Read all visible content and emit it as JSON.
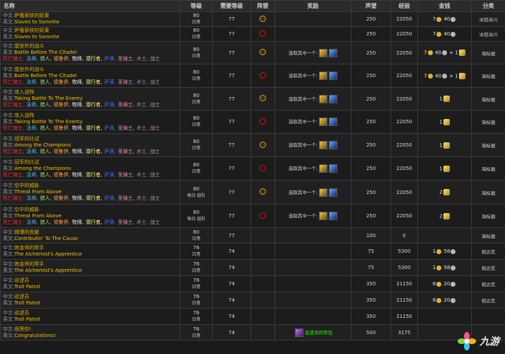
{
  "headers": {
    "name": "名称",
    "level": "等级",
    "req_level": "需要等级",
    "faction": "阵营",
    "reward": "奖励",
    "reputation": "声望",
    "exp": "经验",
    "money": "金钱",
    "category": "分类"
  },
  "prefix_cn": "中文:",
  "prefix_en": "英文:",
  "classes": [
    {
      "label": "死亡骑士,",
      "cls": "c-dk"
    },
    {
      "label": "法师,",
      "cls": "c-mage"
    },
    {
      "label": "猎人,",
      "cls": "c-hunter"
    },
    {
      "label": "德鲁伊,",
      "cls": "c-druid"
    },
    {
      "label": "牧师,",
      "cls": "c-priest"
    },
    {
      "label": "潜行者,",
      "cls": "c-rogue"
    },
    {
      "label": "萨满,",
      "cls": "c-shaman"
    },
    {
      "label": "圣骑士,",
      "cls": "c-paladin"
    },
    {
      "label": "术士,",
      "cls": "c-warlock"
    },
    {
      "label": "战士",
      "cls": "c-warrior"
    }
  ],
  "reward_choose": "选取其中一个:",
  "rows": [
    {
      "cn": "萨隆邪铁的奴隶",
      "en": "Slaves to Saronite",
      "classes": false,
      "level": "80",
      "level_sub": "日常",
      "req": "77",
      "faction": "alliance",
      "reward": "",
      "rep": "250",
      "exp": "22050",
      "gold": "7",
      "silver": "40",
      "emblem": "",
      "cat": "冰冠冰川"
    },
    {
      "cn": "萨隆邪铁的奴隶",
      "en": "Slaves to Saronite",
      "classes": false,
      "level": "80",
      "level_sub": "日常",
      "req": "77",
      "faction": "horde",
      "reward": "",
      "rep": "250",
      "exp": "22050",
      "gold": "7",
      "silver": "40",
      "emblem": "",
      "cat": "冰冠冰川"
    },
    {
      "cn": "堡垒外的战斗",
      "en": "Battle Before The Citadel",
      "classes": true,
      "level": "80",
      "level_sub": "日常",
      "req": "77",
      "faction": "alliance",
      "reward": "choose",
      "rep": "250",
      "exp": "22050",
      "gold": "7",
      "silver": "40",
      "emblem": "+ 1",
      "cat": "海标器"
    },
    {
      "cn": "堡垒外的战斗",
      "en": "Battle Before The Citadel",
      "classes": true,
      "level": "80",
      "level_sub": "日常",
      "req": "77",
      "faction": "horde",
      "reward": "choose",
      "rep": "250",
      "exp": "22050",
      "gold": "7",
      "silver": "40",
      "emblem": "+ 1",
      "cat": "海标器"
    },
    {
      "cn": "攻入战阵",
      "en": "Taking Battle To The Enemy",
      "classes": true,
      "level": "80",
      "level_sub": "日常",
      "req": "77",
      "faction": "alliance",
      "reward": "choose",
      "rep": "250",
      "exp": "22050",
      "gold": "",
      "silver": "",
      "emblem": "1",
      "cat": "海标器"
    },
    {
      "cn": "攻入战阵",
      "en": "Taking Battle To The Enemy",
      "classes": true,
      "level": "80",
      "level_sub": "日常",
      "req": "77",
      "faction": "horde",
      "reward": "choose",
      "rep": "250",
      "exp": "22050",
      "gold": "",
      "silver": "",
      "emblem": "1",
      "cat": "海标器"
    },
    {
      "cn": "冠军的比试",
      "en": "Among the Champions",
      "classes": true,
      "level": "80",
      "level_sub": "日常",
      "req": "77",
      "faction": "alliance",
      "reward": "choose",
      "rep": "250",
      "exp": "22050",
      "gold": "",
      "silver": "",
      "emblem": "1",
      "cat": "海标器"
    },
    {
      "cn": "冠军的比试",
      "en": "Among the Champions",
      "classes": true,
      "level": "80",
      "level_sub": "日常",
      "req": "77",
      "faction": "horde",
      "reward": "choose",
      "rep": "250",
      "exp": "22050",
      "gold": "",
      "silver": "",
      "emblem": "1",
      "cat": "海标器"
    },
    {
      "cn": "空中的威胁",
      "en": "Threat From Above",
      "classes": true,
      "level": "80",
      "level_sub": "每日 组队",
      "req": "77",
      "faction": "alliance",
      "reward": "choose",
      "rep": "250",
      "exp": "22050",
      "gold": "",
      "silver": "",
      "emblem": "2",
      "cat": "海标器"
    },
    {
      "cn": "空中的威胁",
      "en": "Threat From Above",
      "classes": true,
      "level": "80",
      "level_sub": "每日 组队",
      "req": "77",
      "faction": "horde",
      "reward": "choose",
      "rep": "250",
      "exp": "22050",
      "gold": "",
      "silver": "",
      "emblem": "2",
      "cat": "海标器"
    },
    {
      "cn": "微薄的贡献",
      "en": "Contributin' To The Cause",
      "classes": false,
      "level": "80",
      "level_sub": "日常",
      "req": "77",
      "faction": "",
      "reward": "",
      "rep": "100",
      "exp": "0",
      "gold": "",
      "silver": "",
      "emblem": "",
      "cat": "海标器"
    },
    {
      "cn": "炼金师的帮手",
      "en": "The Alchemist's Apprentice",
      "classes": false,
      "level": "76",
      "level_sub": "日常",
      "req": "74",
      "faction": "",
      "reward": "",
      "rep": "75",
      "exp": "5300",
      "gold": "1",
      "silver": "58",
      "emblem": "",
      "cat": "祖达克"
    },
    {
      "cn": "炼金师的帮手",
      "en": "The Alchemist's Apprentice",
      "classes": false,
      "level": "76",
      "level_sub": "日常",
      "req": "74",
      "faction": "",
      "reward": "",
      "rep": "75",
      "exp": "5300",
      "gold": "1",
      "silver": "58",
      "emblem": "",
      "cat": "祖达克"
    },
    {
      "cn": "巡逻员",
      "en": "Troll Patrol",
      "classes": false,
      "level": "76",
      "level_sub": "日常",
      "req": "74",
      "faction": "",
      "reward": "",
      "rep": "350",
      "exp": "21150",
      "gold": "6",
      "silver": "20",
      "emblem": "",
      "cat": "祖达克"
    },
    {
      "cn": "巡逻员",
      "en": "Troll Patrol",
      "classes": false,
      "level": "76",
      "level_sub": "日常",
      "req": "74",
      "faction": "",
      "reward": "",
      "rep": "350",
      "exp": "21150",
      "gold": "6",
      "silver": "20",
      "emblem": "",
      "cat": "祖达克"
    },
    {
      "cn": "巡逻员",
      "en": "Troll Patrol",
      "classes": false,
      "level": "76",
      "level_sub": "日常",
      "req": "74",
      "faction": "",
      "reward": "",
      "rep": "350",
      "exp": "21150",
      "gold": "",
      "silver": "",
      "emblem": "",
      "cat": ""
    },
    {
      "cn": "祝贺你!",
      "en": "Congratulations!",
      "classes": false,
      "level": "76",
      "level_sub": "日常",
      "req": "74",
      "faction": "",
      "reward": "bag",
      "rep": "500",
      "exp": "3175",
      "gold": "",
      "silver": "",
      "emblem": "",
      "cat": ""
    }
  ],
  "bag_reward_label": "巡逻员的背包",
  "watermark_text": "九游"
}
